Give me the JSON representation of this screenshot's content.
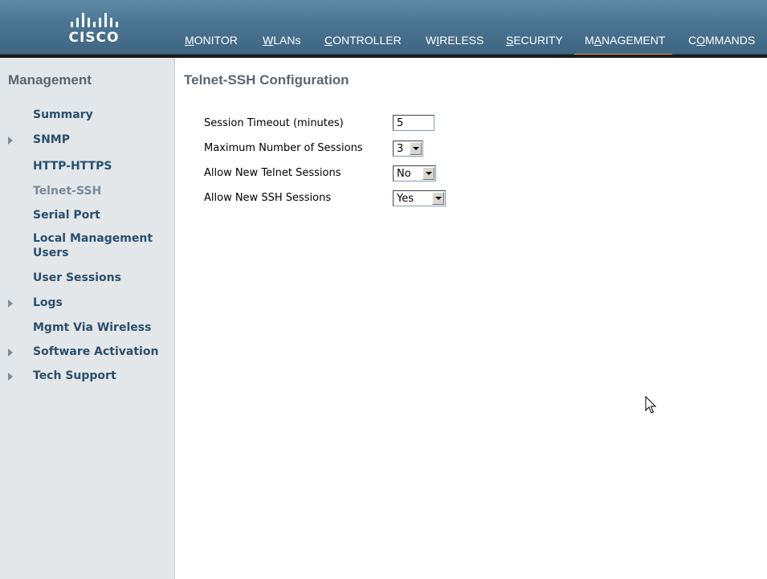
{
  "brand": {
    "logo_text": "CISCO"
  },
  "nav": {
    "items": [
      {
        "label_pre": "",
        "label_ul": "M",
        "label_post": "ONITOR",
        "active": false
      },
      {
        "label_pre": "",
        "label_ul": "W",
        "label_post": "LANs",
        "active": false
      },
      {
        "label_pre": "",
        "label_ul": "C",
        "label_post": "ONTROLLER",
        "active": false
      },
      {
        "label_pre": "W",
        "label_ul": "I",
        "label_post": "RELESS",
        "active": false
      },
      {
        "label_pre": "",
        "label_ul": "S",
        "label_post": "ECURITY",
        "active": false
      },
      {
        "label_pre": "M",
        "label_ul": "A",
        "label_post": "NAGEMENT",
        "active": true
      },
      {
        "label_pre": "C",
        "label_ul": "O",
        "label_post": "MMANDS",
        "active": false
      }
    ]
  },
  "sidebar": {
    "title": "Management",
    "items": [
      {
        "label": "Summary"
      },
      {
        "label": "SNMP"
      },
      {
        "label": "HTTP-HTTPS"
      },
      {
        "label": "Telnet-SSH"
      },
      {
        "label": "Serial Port"
      },
      {
        "label": "Local Management Users"
      },
      {
        "label": "User Sessions"
      },
      {
        "label": "Logs"
      },
      {
        "label": "Mgmt Via Wireless"
      },
      {
        "label": "Software Activation"
      },
      {
        "label": "Tech Support"
      }
    ]
  },
  "main": {
    "title": "Telnet-SSH Configuration",
    "session_timeout": {
      "label": "Session Timeout (minutes)",
      "value": "5"
    },
    "max_sessions": {
      "label": "Maximum Number of Sessions",
      "value": "3"
    },
    "allow_telnet": {
      "label": "Allow New Telnet Sessions",
      "value": "No"
    },
    "allow_ssh": {
      "label": "Allow New SSH Sessions",
      "value": "Yes"
    }
  },
  "colors": {
    "header": "#4a7492",
    "active_underline": "#f49a2e",
    "sidebar_bg": "#e3e7ea",
    "sidebar_link": "#2a4e6c"
  }
}
